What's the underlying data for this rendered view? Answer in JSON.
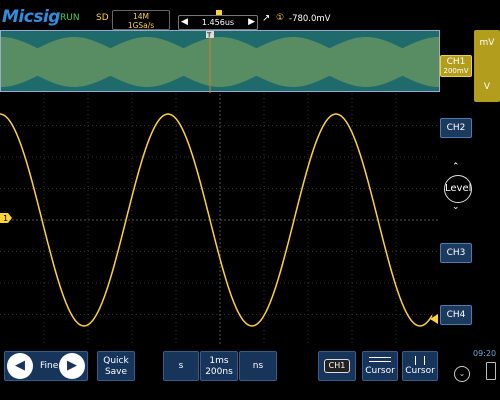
{
  "topbar": {
    "brand": "Micsig",
    "run_status": "RUN",
    "mode": "SD",
    "memory_depth": "14M",
    "sample_rate": "1GSa/s",
    "timebase_offset": "1.456us",
    "trigger_edge_icon": "rising-edge-icon",
    "trigger_channel": "①",
    "trigger_level": "-780.0mV"
  },
  "right_panel": {
    "ch1_label": "CH1",
    "ch1_scale": "200mV",
    "unit_upper": "mV",
    "unit_lower": "V",
    "ch2_label": "CH2",
    "ch3_label": "CH3",
    "ch4_label": "CH4",
    "level_label": "Level"
  },
  "bottom": {
    "fine_label": "Fine",
    "quick_save_line1": "Quick",
    "quick_save_line2": "Save",
    "unit_s": "s",
    "timebase_line1": "1ms",
    "timebase_line2": "200ns",
    "unit_ns": "ns",
    "ch_select": "CH1",
    "cursor1_label": "Cursor",
    "cursor2_label": "Cursor",
    "clock": "09:20"
  },
  "markers": {
    "ch1_marker": "1",
    "trigger_marker": "T"
  },
  "colors": {
    "ch1_trace": "#ffd23a",
    "overview_bg": "#1f6a6a",
    "button_bg": "#17345a",
    "accent_blue": "#2f8ee0",
    "run_green": "#3fd23f"
  }
}
